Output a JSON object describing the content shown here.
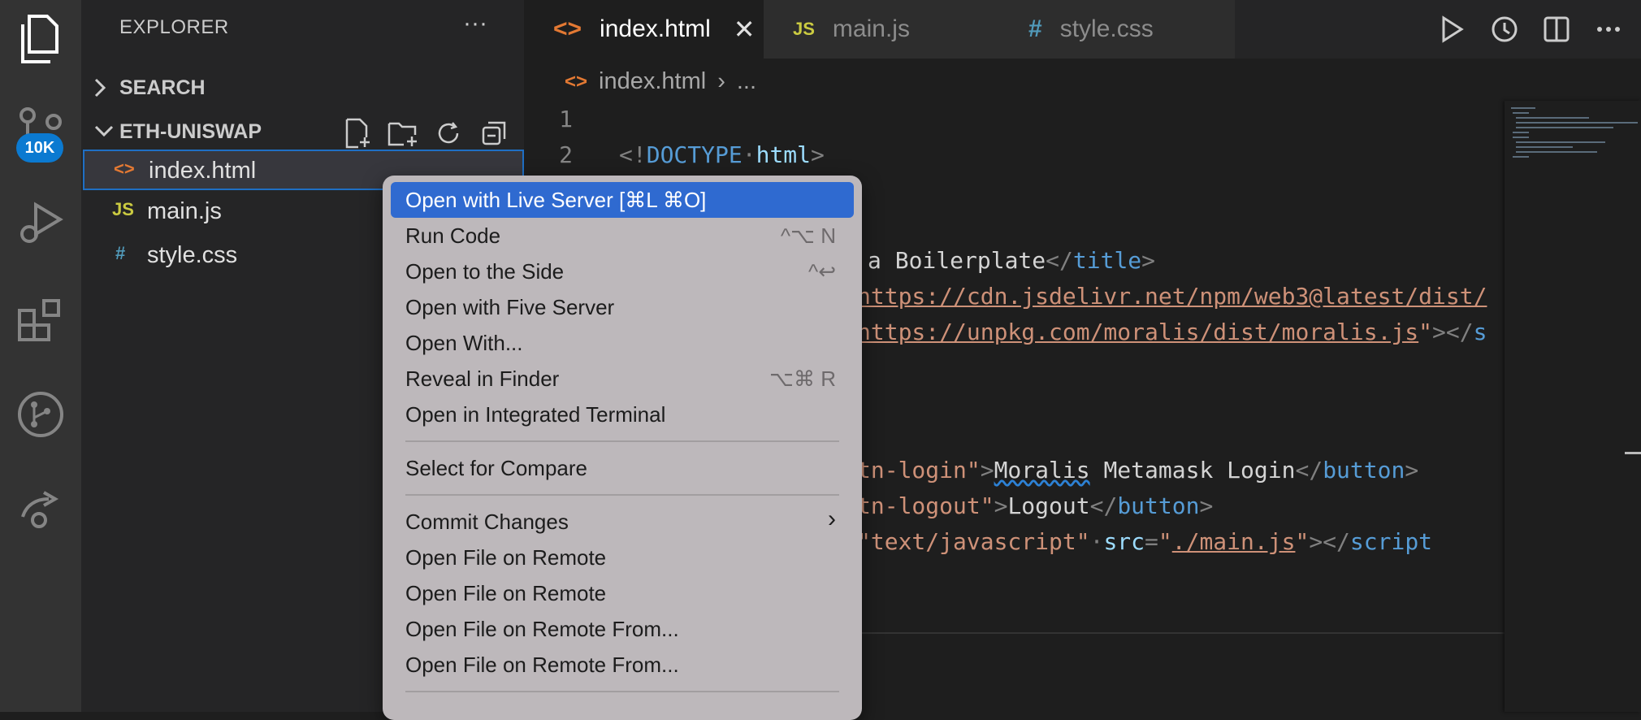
{
  "activity_bar": {
    "badge": "10K",
    "icons": [
      "explorer-icon",
      "source-control-icon",
      "run-debug-icon",
      "extensions-icon",
      "git-graph-icon",
      "remote-icon"
    ]
  },
  "sidebar": {
    "title": "EXPLORER",
    "more": "···",
    "search_section": "SEARCH",
    "folder": "ETH-UNISWAP",
    "files": [
      {
        "icon": "<>",
        "name": "index.html",
        "color": "#e37933"
      },
      {
        "icon": "JS",
        "name": "main.js",
        "color": "#cbcb41"
      },
      {
        "icon": "#",
        "name": "style.css",
        "color": "#519aba"
      }
    ]
  },
  "tabs": [
    {
      "icon": "<>",
      "label": "index.html",
      "close": "✕",
      "color": "#e37933"
    },
    {
      "icon": "JS",
      "label": "main.js",
      "color": "#cbcb41"
    },
    {
      "icon": "#",
      "label": "style.css",
      "color": "#519aba"
    }
  ],
  "breadcrumb": {
    "icon": "<>",
    "file": "index.html",
    "sep": "›",
    "rest": "..."
  },
  "code": {
    "line_numbers": [
      "1",
      "2"
    ],
    "line2": {
      "open": "<!",
      "doctype": "DOCTYPE",
      "html": "html",
      "close": ">"
    },
    "title_text": "a Boilerplate",
    "title_close_open": "</",
    "title_tag": "title",
    "title_close": ">",
    "web3_src": "https://cdn.jsdelivr.net/npm/web3@latest/dist/",
    "moralis_src": "https://unpkg.com/moralis/dist/moralis.js",
    "moralis_tail_punc": "\"></",
    "moralis_tail_tag": "s",
    "btn_login_id": "tn-login\"",
    "btn_login_text1": "Moralis",
    "btn_login_text2": " Metamask Login",
    "btn_tag": "button",
    "btn_logout_id": "tn-logout\"",
    "btn_logout_text": "Logout",
    "script_type": "\"text/javascript\"",
    "script_src_attr": "src",
    "script_src": "./main.js",
    "script_tag": "script"
  },
  "context_menu": {
    "items": [
      {
        "label": "Open with Live Server [⌘L ⌘O]",
        "shortcut": "",
        "highlighted": true
      },
      {
        "label": "Run Code",
        "shortcut": "^⌥ N"
      },
      {
        "label": "Open to the Side",
        "shortcut": "^↩"
      },
      {
        "label": "Open with Five Server",
        "shortcut": ""
      },
      {
        "label": "Open With...",
        "shortcut": ""
      },
      {
        "label": "Reveal in Finder",
        "shortcut": "⌥⌘ R"
      },
      {
        "label": "Open in Integrated Terminal",
        "shortcut": ""
      },
      {
        "label": "Select for Compare",
        "shortcut": ""
      },
      {
        "label": "Commit Changes",
        "shortcut": "›"
      },
      {
        "label": "Open File on Remote",
        "shortcut": ""
      },
      {
        "label": "Open File on Remote",
        "shortcut": ""
      },
      {
        "label": "Open File on Remote From...",
        "shortcut": ""
      },
      {
        "label": "Open File on Remote From...",
        "shortcut": ""
      }
    ]
  }
}
